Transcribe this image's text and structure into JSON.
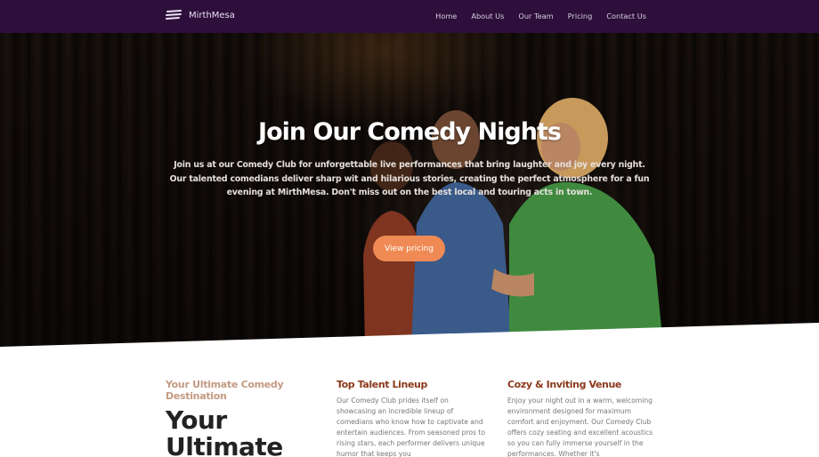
{
  "nav": {
    "brand": "MirthMesa",
    "logo_icon": "waves-logo-icon",
    "links": [
      "Home",
      "About Us",
      "Our Team",
      "Pricing",
      "Contact Us"
    ]
  },
  "hero": {
    "title": "Join Our Comedy Nights",
    "subtitle": "Join us at our Comedy Club for unforgettable live performances that bring laughter and joy every night. Our talented comedians deliver sharp wit and hilarious stories, creating the perfect atmosphere for a fun evening at MirthMesa. Don't miss out on the best local and touring acts in town.",
    "cta": "View pricing"
  },
  "intro": {
    "eyebrow": "Your Ultimate Comedy Destination",
    "heading": "Your Ultimate"
  },
  "features": [
    {
      "title": "Top Talent Lineup",
      "text": "Our Comedy Club prides itself on showcasing an incredible lineup of comedians who know how to captivate and entertain audiences. From seasoned pros to rising stars, each performer delivers unique humor that keeps you"
    },
    {
      "title": "Cozy & Inviting Venue",
      "text": "Enjoy your night out in a warm, welcoming environment designed for maximum comfort and enjoyment. Our Comedy Club offers cozy seating and excellent acoustics so you can fully immerse yourself in the performances. Whether it's"
    }
  ],
  "colors": {
    "nav_bg": "#2e0f3c",
    "accent": "#f08a55",
    "feature_title": "#8a3a1c",
    "eyebrow": "#c49a82"
  }
}
